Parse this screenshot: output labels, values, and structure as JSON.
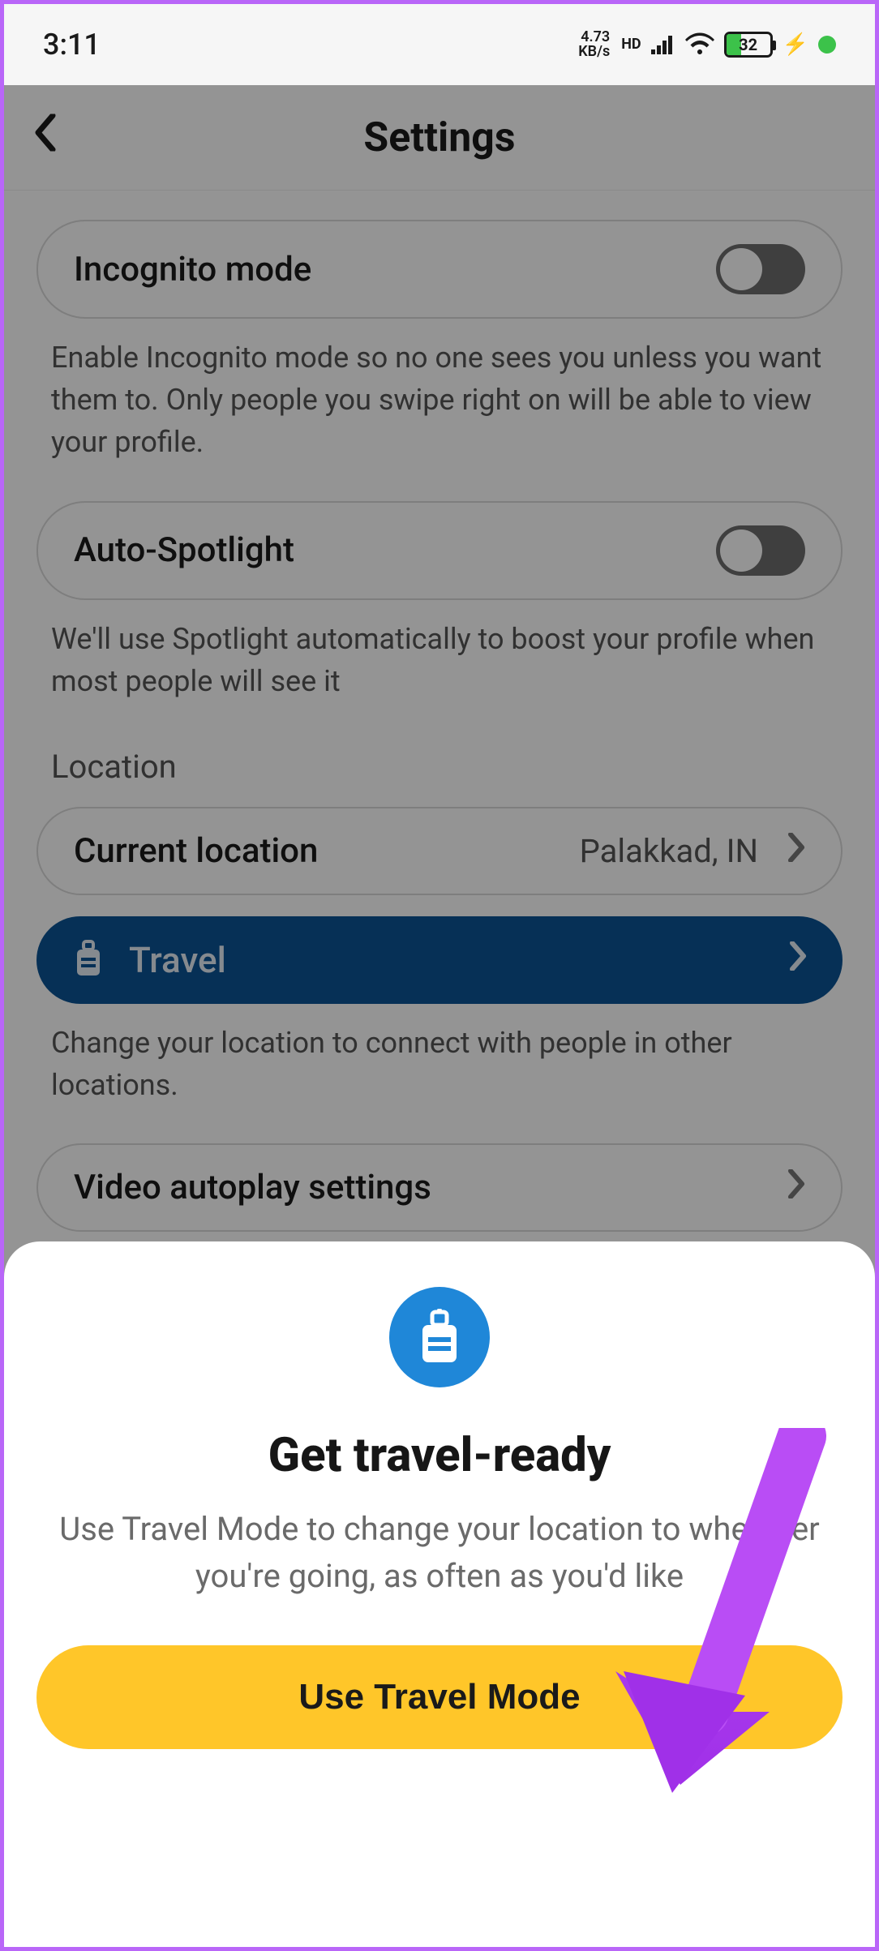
{
  "statusbar": {
    "time": "3:11",
    "kbs_top": "4.73",
    "kbs_bottom": "KB/s",
    "hd": "HD",
    "battery_pct": "32"
  },
  "header": {
    "title": "Settings"
  },
  "settings": {
    "incognito": {
      "label": "Incognito mode",
      "desc": "Enable Incognito mode so no one sees you unless you want them to. Only people you swipe right on will be able to view your profile."
    },
    "autospotlight": {
      "label": "Auto-Spotlight",
      "desc": "We'll use Spotlight automatically to boost your profile when most people will see it"
    },
    "location_section": "Location",
    "current_location": {
      "label": "Current location",
      "value": "Palakkad, IN"
    },
    "travel": {
      "label": "Travel",
      "desc": "Change your location to connect with people in other locations."
    },
    "video_autoplay": {
      "label": "Video autoplay settings"
    }
  },
  "sheet": {
    "title": "Get travel-ready",
    "desc": "Use Travel Mode to change your location to wherever you're going, as often as you'd like",
    "cta": "Use Travel Mode"
  }
}
